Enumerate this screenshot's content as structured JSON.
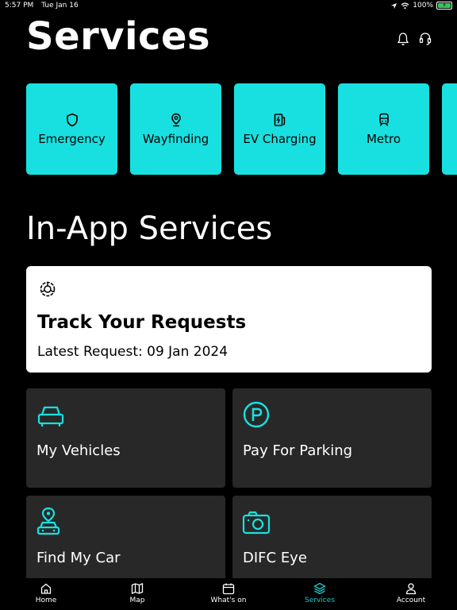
{
  "status": {
    "time": "5:57 PM",
    "date": "Tue Jan 16",
    "battery": "100%"
  },
  "header": {
    "title": "Services",
    "icons": [
      "bell-icon",
      "headset-icon"
    ]
  },
  "quick_services": [
    {
      "label": "Emergency",
      "icon": "shield-icon"
    },
    {
      "label": "Wayfinding",
      "icon": "location-pin-icon"
    },
    {
      "label": "EV Charging",
      "icon": "ev-charger-icon"
    },
    {
      "label": "Metro",
      "icon": "train-icon"
    }
  ],
  "in_app": {
    "title": "In-App Services",
    "track": {
      "title": "Track Your Requests",
      "subtitle": "Latest Request: 09 Jan 2024",
      "icon": "gear-icon"
    },
    "cards": [
      {
        "label": "My Vehicles",
        "icon": "car-icon"
      },
      {
        "label": "Pay For Parking",
        "icon": "parking-icon"
      },
      {
        "label": "Find My Car",
        "icon": "car-location-icon"
      },
      {
        "label": "DIFC Eye",
        "icon": "camera-icon"
      }
    ]
  },
  "tabs": [
    {
      "label": "Home",
      "icon": "home-icon",
      "active": false
    },
    {
      "label": "Map",
      "icon": "map-icon",
      "active": false
    },
    {
      "label": "What's on",
      "icon": "calendar-icon",
      "active": false
    },
    {
      "label": "Services",
      "icon": "layers-icon",
      "active": true
    },
    {
      "label": "Account",
      "icon": "user-icon",
      "active": false
    }
  ],
  "colors": {
    "accent": "#19e0e0",
    "active_tab": "#19c8c8",
    "card_dark": "#282828",
    "background": "#000000"
  }
}
